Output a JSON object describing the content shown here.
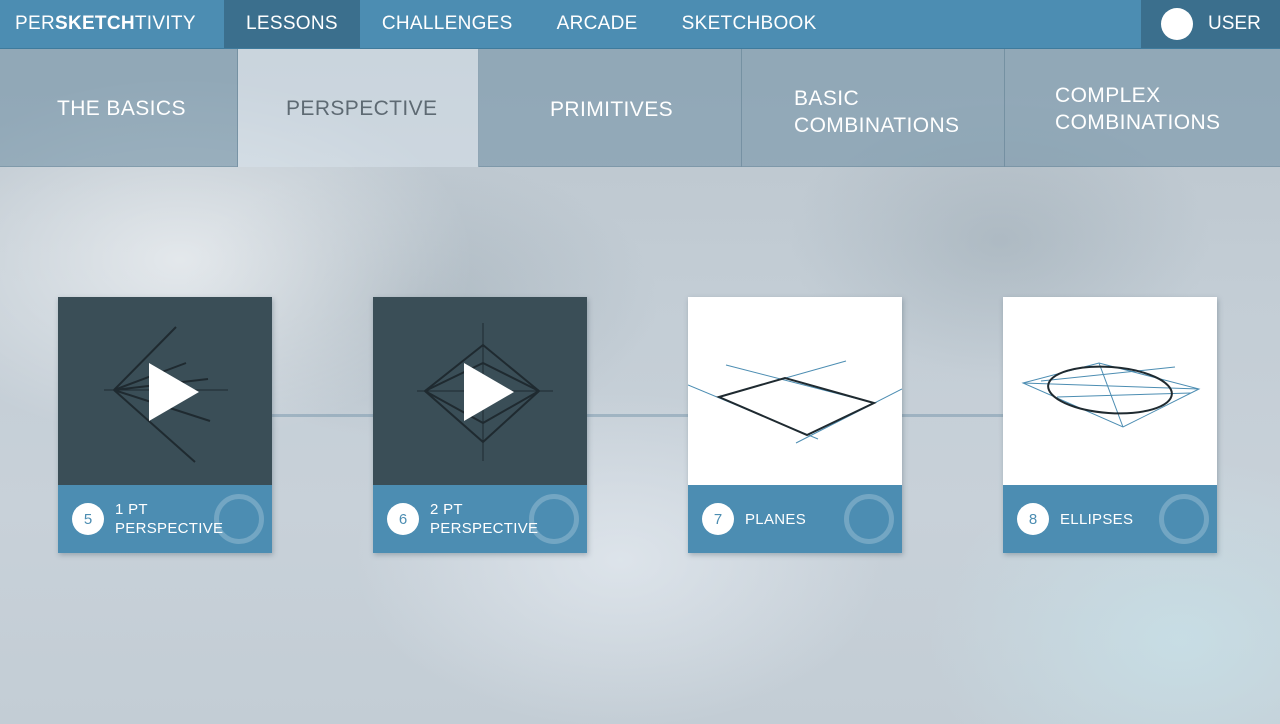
{
  "brand": {
    "prefix": "PER",
    "bold": "SKETCH",
    "suffix": "TIVITY"
  },
  "nav": {
    "items": [
      {
        "label": "LESSONS"
      },
      {
        "label": "CHALLENGES"
      },
      {
        "label": "ARCADE"
      },
      {
        "label": "SKETCHBOOK"
      }
    ],
    "active": "LESSONS",
    "user_label": "USER"
  },
  "subtabs": [
    {
      "label": "THE BASICS"
    },
    {
      "label": "PERSPECTIVE"
    },
    {
      "label": "PRIMITIVES"
    },
    {
      "label": "BASIC\nCOMBINATIONS"
    },
    {
      "label": "COMPLEX\nCOMBINATIONS"
    }
  ],
  "active_subtab": "PERSPECTIVE",
  "lessons": [
    {
      "number": "5",
      "title": "1 PT\nPERSPECTIVE",
      "thumbnail": "play-video-icon"
    },
    {
      "number": "6",
      "title": "2 PT\nPERSPECTIVE",
      "thumbnail": "play-video-icon"
    },
    {
      "number": "7",
      "title": "PLANES",
      "thumbnail": "plane-drawing"
    },
    {
      "number": "8",
      "title": "ELLIPSES",
      "thumbnail": "ellipse-drawing"
    }
  ],
  "colors": {
    "accent": "#4c8db2",
    "accent_dark": "#3b6f8d",
    "thumb_dark": "#3a4e57",
    "guide_line": "#4c8db2",
    "stroke": "#1f2a30"
  }
}
